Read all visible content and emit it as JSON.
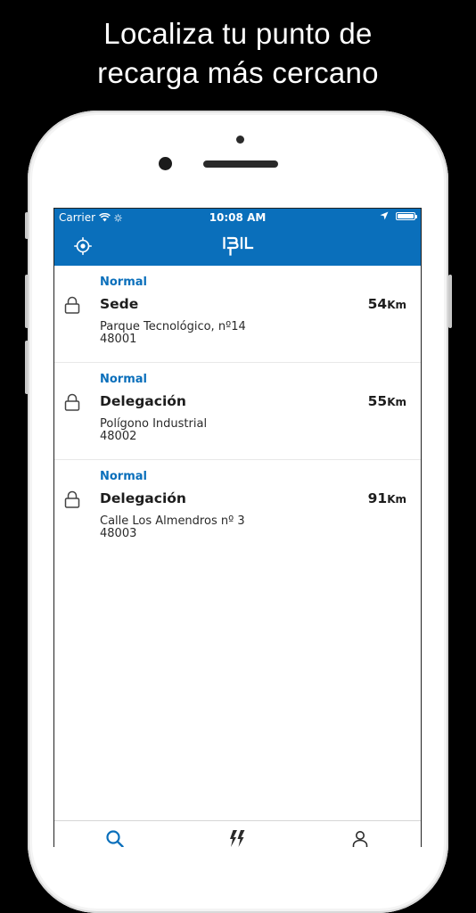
{
  "headline": {
    "line1": "Localiza tu punto de",
    "line2": "recarga más cercano"
  },
  "status_bar": {
    "carrier": "Carrier",
    "time": "10:08 AM"
  },
  "app": {
    "logo": "IBIL",
    "accent_color": "#0a6fbb"
  },
  "stations": [
    {
      "type": "Normal",
      "name": "Sede",
      "distance_value": "54",
      "distance_unit": "Km",
      "address_line1": "Parque Tecnológico, nº14",
      "address_line2": "48001"
    },
    {
      "type": "Normal",
      "name": "Delegación",
      "distance_value": "55",
      "distance_unit": "Km",
      "address_line1": "Polígono Industrial",
      "address_line2": "48002"
    },
    {
      "type": "Normal",
      "name": "Delegación",
      "distance_value": "91",
      "distance_unit": "Km",
      "address_line1": "Calle Los Almendros nº 3",
      "address_line2": "48003"
    }
  ],
  "tabs": [
    {
      "icon": "search-icon"
    },
    {
      "icon": "charge-icon"
    },
    {
      "icon": "user-icon"
    }
  ]
}
